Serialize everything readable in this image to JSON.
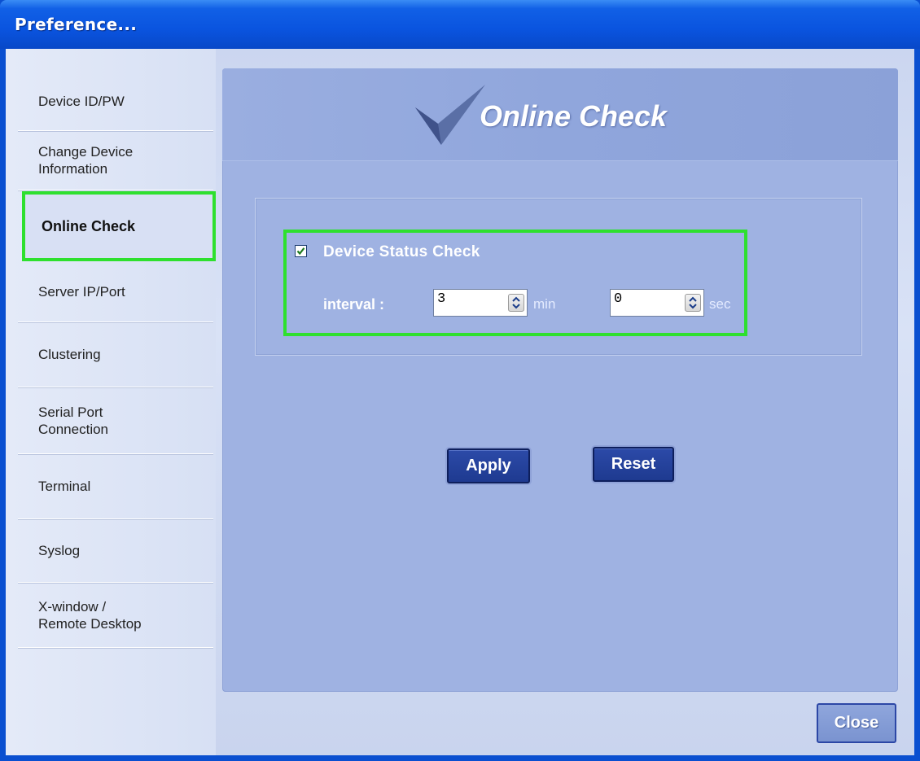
{
  "window": {
    "title": "Preference..."
  },
  "sidebar": {
    "items": [
      {
        "label": "Device ID/PW"
      },
      {
        "label": "Change Device\nInformation"
      },
      {
        "label": "Online Check"
      },
      {
        "label": "Server IP/Port"
      },
      {
        "label": "Clustering"
      },
      {
        "label": "Serial Port\nConnection"
      },
      {
        "label": "Terminal"
      },
      {
        "label": "Syslog"
      },
      {
        "label": "X-window /\nRemote Desktop"
      }
    ],
    "active": "Online Check"
  },
  "panel": {
    "title": "Online Check",
    "device_status_check": {
      "label": "Device Status Check",
      "checked": true
    },
    "interval_label": "interval :",
    "minutes": {
      "value": "3",
      "unit": "min"
    },
    "seconds": {
      "value": "0",
      "unit": "sec"
    },
    "apply_label": "Apply",
    "reset_label": "Reset"
  },
  "close_label": "Close",
  "colors": {
    "highlight": "#2ee02e",
    "titlebar": "#0a54df",
    "panel": "#9fb2e2",
    "button": "#1e3a90"
  }
}
